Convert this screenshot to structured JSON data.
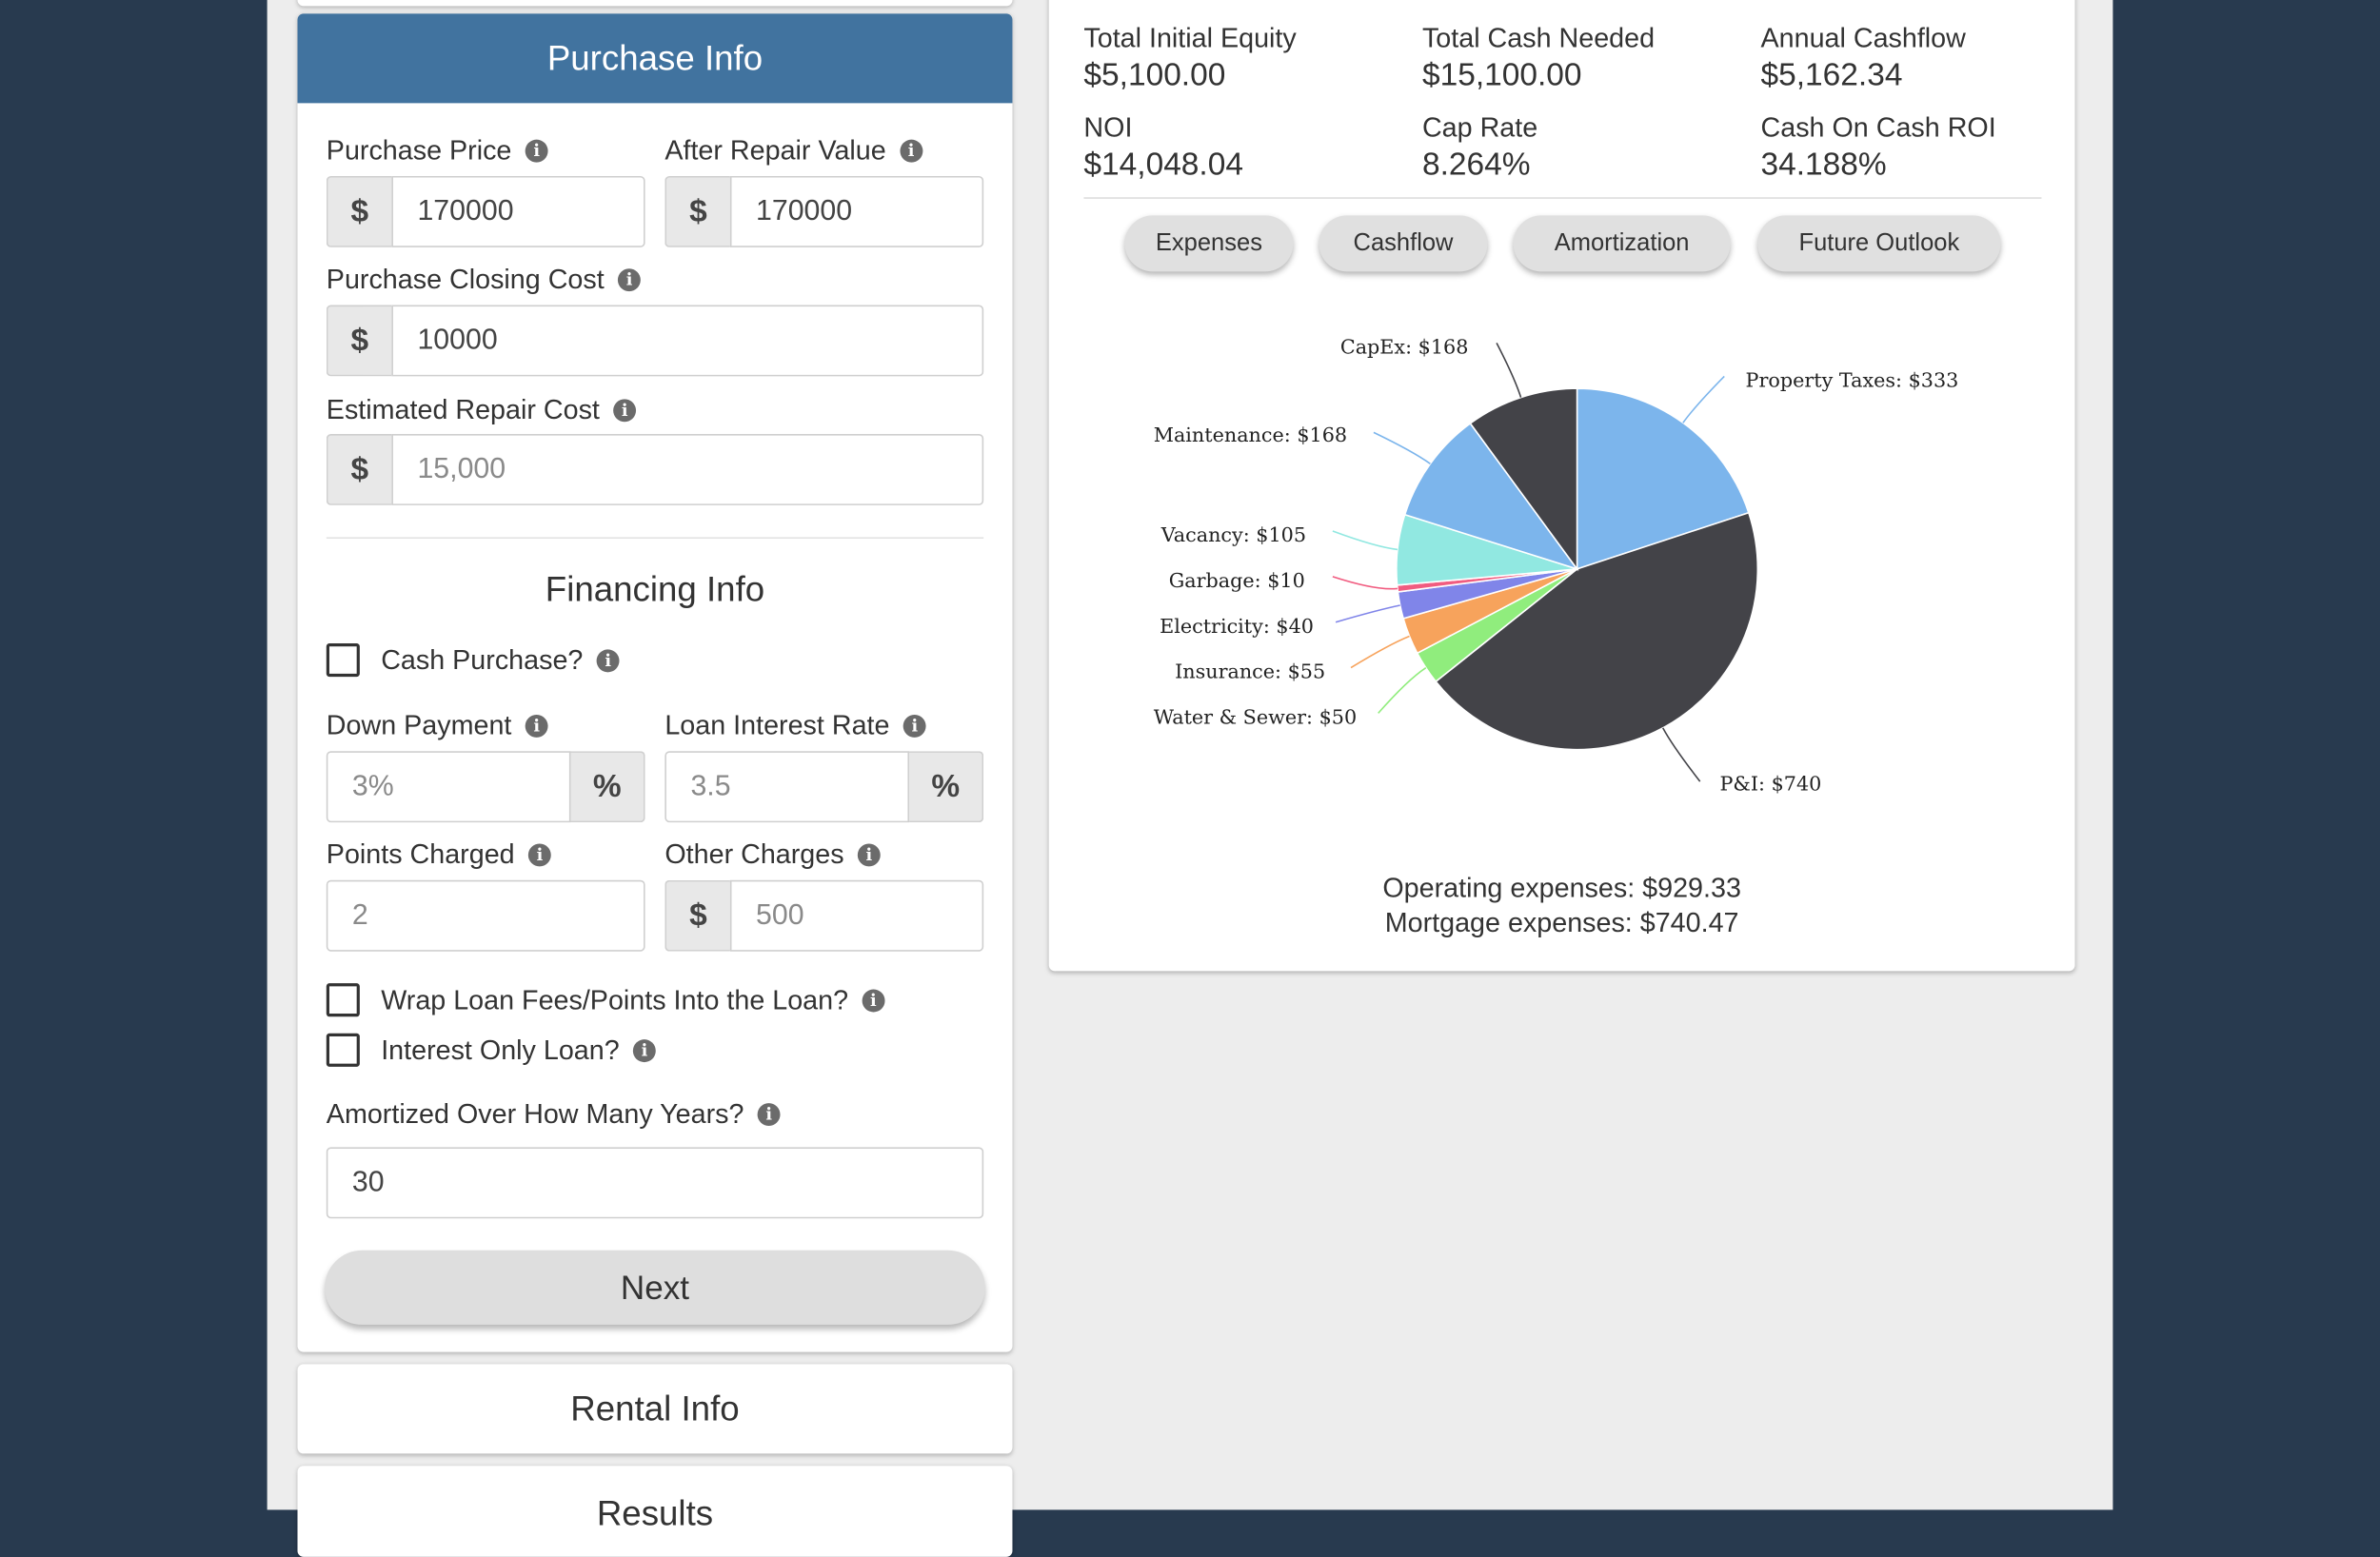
{
  "purchase": {
    "header": "Purchase Info",
    "purchase_price": {
      "label": "Purchase Price",
      "prefix": "$",
      "value": "170000"
    },
    "after_repair_value": {
      "label": "After Repair Value",
      "prefix": "$",
      "value": "170000"
    },
    "closing_cost": {
      "label": "Purchase Closing Cost",
      "prefix": "$",
      "value": "10000"
    },
    "repair_cost": {
      "label": "Estimated Repair Cost",
      "prefix": "$",
      "placeholder": "15,000"
    }
  },
  "financing": {
    "title": "Financing Info",
    "cash_purchase_label": "Cash Purchase?",
    "down_payment": {
      "label": "Down Payment",
      "placeholder": "3%",
      "suffix": "%"
    },
    "interest_rate": {
      "label": "Loan Interest Rate",
      "placeholder": "3.5",
      "suffix": "%"
    },
    "points": {
      "label": "Points Charged",
      "placeholder": "2"
    },
    "other_charges": {
      "label": "Other Charges",
      "prefix": "$",
      "placeholder": "500"
    },
    "wrap_label": "Wrap Loan Fees/Points Into the Loan?",
    "interest_only_label": "Interest Only Loan?",
    "amortized": {
      "label": "Amortized Over How Many Years?",
      "value": "30"
    },
    "next_label": "Next"
  },
  "sections": {
    "rental": "Rental Info",
    "results": "Results"
  },
  "metrics": [
    {
      "label": "Total Initial Equity",
      "value": "$5,100.00"
    },
    {
      "label": "Total Cash Needed",
      "value": "$15,100.00"
    },
    {
      "label": "Annual Cashflow",
      "value": "$5,162.34"
    },
    {
      "label": "NOI",
      "value": "$14,048.04"
    },
    {
      "label": "Cap Rate",
      "value": "8.264%"
    },
    {
      "label": "Cash On Cash ROI",
      "value": "34.188%"
    }
  ],
  "tabs": [
    "Expenses",
    "Cashflow",
    "Amortization",
    "Future Outlook"
  ],
  "chart_data": {
    "type": "pie",
    "slices": [
      {
        "label": "Property Taxes: $333",
        "value": 333,
        "color": "#7cb5ec"
      },
      {
        "label": "P&I: $740",
        "value": 740,
        "color": "#434348"
      },
      {
        "label": "Water & Sewer: $50",
        "value": 50,
        "color": "#90ed7d"
      },
      {
        "label": "Insurance: $55",
        "value": 55,
        "color": "#f7a35c"
      },
      {
        "label": "Electricity: $40",
        "value": 40,
        "color": "#8085e9"
      },
      {
        "label": "Garbage: $10",
        "value": 10,
        "color": "#f15c80"
      },
      {
        "label": "Vacancy: $105",
        "value": 105,
        "color": "#91e8e1"
      },
      {
        "label": "Maintenance: $168",
        "value": 168,
        "color": "#7cb5ec"
      },
      {
        "label": "CapEx: $168",
        "value": 168,
        "color": "#434348"
      }
    ]
  },
  "totals": {
    "operating": "Operating expenses: $929.33",
    "mortgage": "Mortgage expenses: $740.47"
  },
  "colors": {
    "background": "#283a4f",
    "header": "#41739f",
    "panel": "#ededed"
  }
}
